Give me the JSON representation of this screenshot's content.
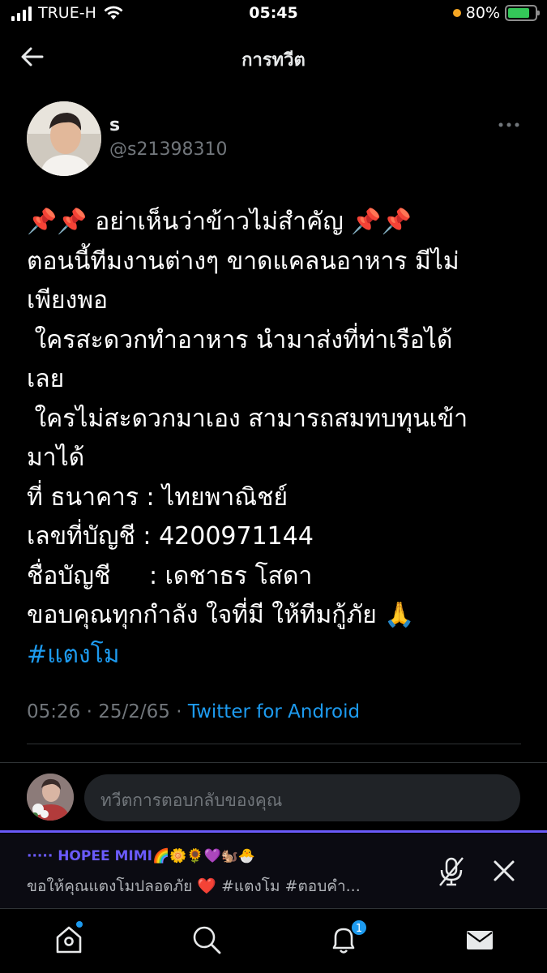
{
  "status_bar": {
    "carrier": "TRUE-H",
    "time": "05:45",
    "battery": "80%",
    "battery_level": 0.8
  },
  "header": {
    "title": "การทวีต"
  },
  "tweet": {
    "name": "s",
    "handle": "@s21398310",
    "lines": [
      "📌📌 อย่าเห็นว่าข้าวไม่สำคัญ 📌📌",
      "ตอนนี้ทีมงานต่างๆ ขาดแคลนอาหาร มีไม่",
      "เพียงพอ",
      " ใครสะดวกทำอาหาร นำมาส่งที่ท่าเรือได้",
      "เลย",
      " ใครไม่สะดวกมาเอง สามารถสมทบทุนเข้า",
      "มาได้",
      "ที่ ธนาคาร : ไทยพาณิชย์",
      "เลขที่บัญชี : 4200971144",
      "ชื่อบัญชี     : เดชาธร โสดา",
      "ขอบคุณทุกกำลัง ใจที่มี ให้ทีมกู้ภัย 🙏"
    ],
    "hashtag": "#แตงโม",
    "time": "05:26",
    "date": "25/2/65",
    "source": "Twitter for Android"
  },
  "reply": {
    "placeholder": "ทวีตการตอบกลับของคุณ"
  },
  "space": {
    "title": "····· HOPEE MIMI🌈🌼🌻💜🐿️🐣",
    "subtitle": "ขอให้คุณแตงโมปลอดภัย ❤️ #แตงโม #ตอบคำ..."
  },
  "nav": {
    "notifications_count": "1"
  },
  "colors": {
    "accent": "#1d9bf0",
    "space_accent": "#6a5af9",
    "background": "#000000"
  }
}
